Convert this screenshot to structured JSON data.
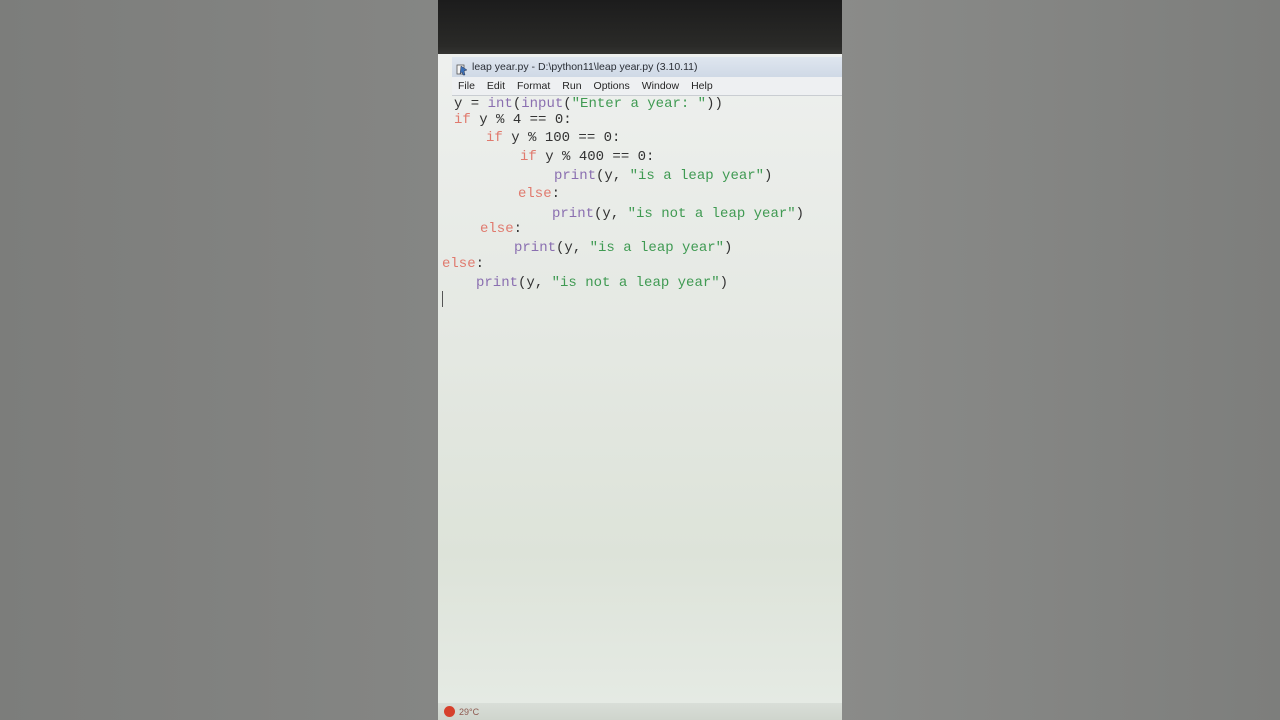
{
  "window": {
    "title": "leap year.py - D:\\python11\\leap year.py (3.10.11)",
    "icon": "python-idle-icon"
  },
  "menu": {
    "items": [
      "File",
      "Edit",
      "Format",
      "Run",
      "Options",
      "Window",
      "Help"
    ]
  },
  "code": {
    "lines": [
      [
        {
          "t": "plain",
          "v": "y = "
        },
        {
          "t": "bi",
          "v": "int"
        },
        {
          "t": "plain",
          "v": "("
        },
        {
          "t": "bi",
          "v": "input"
        },
        {
          "t": "plain",
          "v": "("
        },
        {
          "t": "str",
          "v": "\"Enter a year: \""
        },
        {
          "t": "plain",
          "v": "))"
        }
      ],
      [
        {
          "t": "kw",
          "v": "if"
        },
        {
          "t": "plain",
          "v": " y % 4 == 0:"
        }
      ],
      [
        {
          "t": "kw",
          "v": "if"
        },
        {
          "t": "plain",
          "v": " y % 100 == 0:"
        }
      ],
      [
        {
          "t": "kw",
          "v": "if"
        },
        {
          "t": "plain",
          "v": " y % 400 == 0:"
        }
      ],
      [
        {
          "t": "bi",
          "v": "print"
        },
        {
          "t": "plain",
          "v": "(y, "
        },
        {
          "t": "str",
          "v": "\"is a leap year\""
        },
        {
          "t": "plain",
          "v": ")"
        }
      ],
      [
        {
          "t": "kw",
          "v": "else"
        },
        {
          "t": "plain",
          "v": ":"
        }
      ],
      [
        {
          "t": "bi",
          "v": "print"
        },
        {
          "t": "plain",
          "v": "(y, "
        },
        {
          "t": "str",
          "v": "\"is not a leap year\""
        },
        {
          "t": "plain",
          "v": ")"
        }
      ],
      [
        {
          "t": "kw",
          "v": "else"
        },
        {
          "t": "plain",
          "v": ":"
        }
      ],
      [
        {
          "t": "bi",
          "v": "print"
        },
        {
          "t": "plain",
          "v": "(y, "
        },
        {
          "t": "str",
          "v": "\"is a leap year\""
        },
        {
          "t": "plain",
          "v": ")"
        }
      ],
      [
        {
          "t": "kw",
          "v": "else"
        },
        {
          "t": "plain",
          "v": ":"
        }
      ],
      [
        {
          "t": "bi",
          "v": "print"
        },
        {
          "t": "plain",
          "v": "(y, "
        },
        {
          "t": "str",
          "v": "\"is not a leap year\""
        },
        {
          "t": "plain",
          "v": ")"
        }
      ]
    ]
  },
  "taskbar": {
    "weather": "29°C",
    "weather_icon": "weather-alert-icon"
  },
  "colors": {
    "keyword": "#e07a6e",
    "builtin": "#8a6fb0",
    "string": "#3f9a52"
  }
}
